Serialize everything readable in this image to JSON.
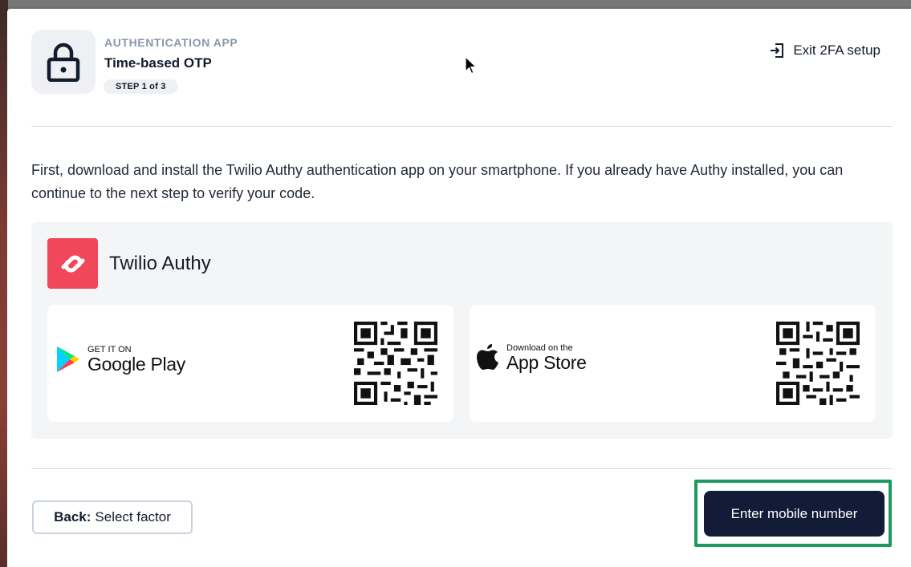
{
  "header": {
    "eyebrow": "AUTHENTICATION APP",
    "title": "Time-based OTP",
    "step": "STEP 1 of 3",
    "exit_label": "Exit 2FA setup",
    "lock_icon": "lock-icon",
    "exit_icon": "exit-icon"
  },
  "intro": "First, download and install the Twilio Authy authentication app on your smartphone. If you already have Authy installed, you can continue to the next step to verify your code.",
  "app": {
    "name": "Twilio Authy",
    "logo_color": "#f0485a",
    "stores": [
      {
        "small": "GET IT ON",
        "big": "Google Play",
        "icon": "google-play-icon"
      },
      {
        "small": "Download on the",
        "big": "App Store",
        "icon": "apple-icon"
      }
    ]
  },
  "footer": {
    "back_bold": "Back:",
    "back_text": "Select factor",
    "primary_label": "Enter mobile number"
  },
  "colors": {
    "primary": "#121c37",
    "focus": "#1f9a5e",
    "accent_brand": "#f0485a"
  }
}
